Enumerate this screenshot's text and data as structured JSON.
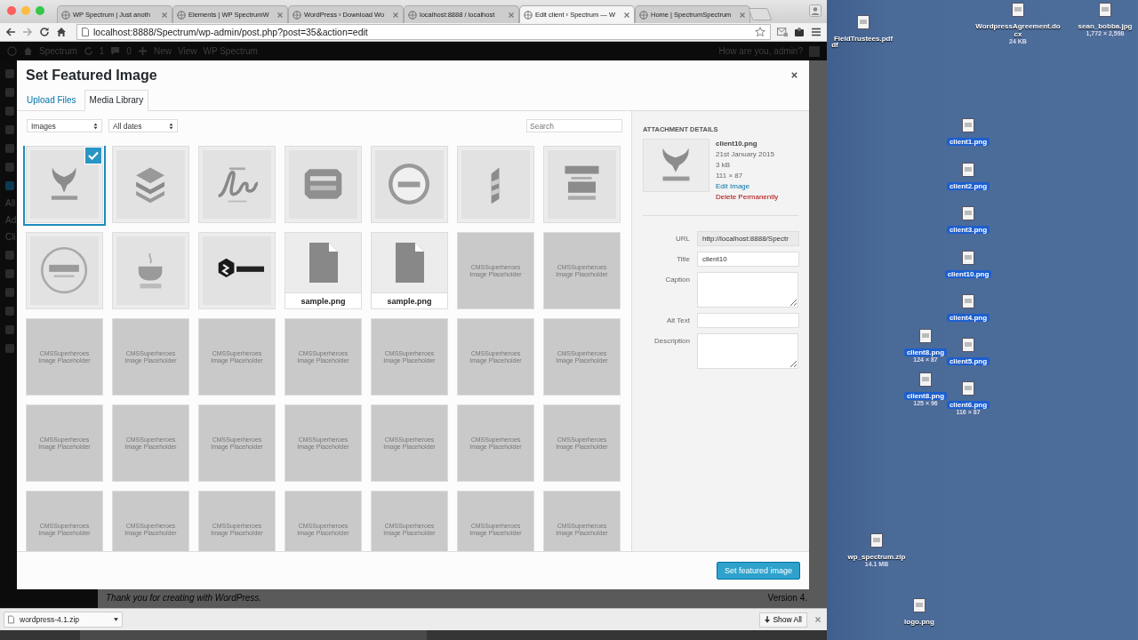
{
  "browser": {
    "tabs": [
      {
        "title": "WP Spectrum | Just anoth",
        "selected": false
      },
      {
        "title": "Elements | WP SpectrumW",
        "selected": false
      },
      {
        "title": "WordPress › Download Wo",
        "selected": false
      },
      {
        "title": "localhost:8888 / localhost",
        "selected": false
      },
      {
        "title": "Edit client ‹ Spectrum — W",
        "selected": true
      },
      {
        "title": "Home | SpectrumSpectrum",
        "selected": false
      }
    ],
    "url": "localhost:8888/Spectrum/wp-admin/post.php?post=35&action=edit"
  },
  "admin_bar": {
    "site": "Spectrum",
    "updates": "1",
    "comments": "0",
    "new": "New",
    "view": "View",
    "menu": "WP Spectrum",
    "greeting": "How are you, admin?"
  },
  "sidebar": {
    "items": [
      "All",
      "Ad",
      "Cli"
    ]
  },
  "modal": {
    "title": "Set Featured Image",
    "tabs": [
      {
        "label": "Upload Files",
        "selected": false
      },
      {
        "label": "Media Library",
        "selected": true
      }
    ],
    "filters": [
      "Images",
      "All dates"
    ],
    "search": {
      "placeholder": "Search"
    },
    "items": [
      {
        "kind": "logo",
        "selected": true
      },
      {
        "kind": "logo",
        "selected": false
      },
      {
        "kind": "logo",
        "selected": false
      },
      {
        "kind": "logo",
        "selected": false
      },
      {
        "kind": "logo",
        "selected": false
      },
      {
        "kind": "logo",
        "selected": false
      },
      {
        "kind": "logo",
        "selected": false
      },
      {
        "kind": "logo",
        "selected": false
      },
      {
        "kind": "logo",
        "selected": false
      },
      {
        "kind": "logo",
        "selected": false
      },
      {
        "kind": "file",
        "filename": "sample.png",
        "selected": false
      },
      {
        "kind": "file",
        "filename": "sample.png",
        "selected": false
      },
      {
        "kind": "placeholder",
        "text": "CMSSuperheroes Image Placeholder",
        "selected": false
      },
      {
        "kind": "placeholder",
        "text": "CMSSuperheroes Image Placeholder",
        "selected": false
      },
      {
        "kind": "placeholder",
        "text": "CMSSuperheroes Image Placeholder",
        "selected": false
      },
      {
        "kind": "placeholder",
        "text": "CMSSuperheroes Image Placeholder",
        "selected": false
      },
      {
        "kind": "placeholder",
        "text": "CMSSuperheroes Image Placeholder",
        "selected": false
      },
      {
        "kind": "placeholder",
        "text": "CMSSuperheroes Image Placeholder",
        "selected": false
      },
      {
        "kind": "placeholder",
        "text": "CMSSuperheroes Image Placeholder",
        "selected": false
      },
      {
        "kind": "placeholder",
        "text": "CMSSuperheroes Image Placeholder",
        "selected": false
      },
      {
        "kind": "placeholder",
        "text": "CMSSuperheroes Image Placeholder",
        "selected": false
      },
      {
        "kind": "placeholder",
        "text": "CMSSuperheroes Image Placeholder",
        "selected": false
      },
      {
        "kind": "placeholder",
        "text": "CMSSuperheroes Image Placeholder",
        "selected": false
      },
      {
        "kind": "placeholder",
        "text": "CMSSuperheroes Image Placeholder",
        "selected": false
      },
      {
        "kind": "placeholder",
        "text": "CMSSuperheroes Image Placeholder",
        "selected": false
      },
      {
        "kind": "placeholder",
        "text": "CMSSuperheroes Image Placeholder",
        "selected": false
      },
      {
        "kind": "placeholder",
        "text": "CMSSuperheroes Image Placeholder",
        "selected": false
      },
      {
        "kind": "placeholder",
        "text": "CMSSuperheroes Image Placeholder",
        "selected": false
      },
      {
        "kind": "placeholder",
        "text": "CMSSuperheroes Image Placeholder",
        "selected": false
      },
      {
        "kind": "placeholder",
        "text": "CMSSuperheroes Image Placeholder",
        "selected": false
      },
      {
        "kind": "placeholder",
        "text": "CMSSuperheroes Image Placeholder",
        "selected": false
      },
      {
        "kind": "placeholder",
        "text": "CMSSuperheroes Image Placeholder",
        "selected": false
      },
      {
        "kind": "placeholder",
        "text": "CMSSuperheroes Image Placeholder",
        "selected": false
      },
      {
        "kind": "placeholder",
        "text": "CMSSuperheroes Image Placeholder",
        "selected": false
      },
      {
        "kind": "placeholder",
        "text": "CMSSuperheroes Image Placeholder",
        "selected": false
      }
    ],
    "details": {
      "heading": "ATTACHMENT DETAILS",
      "filename": "client10.png",
      "date": "21st January 2015",
      "size": "3 kB",
      "dimensions": "111 × 87",
      "edit_link": "Edit Image",
      "delete_link": "Delete Permanently",
      "fields": [
        {
          "label": "URL",
          "kind": "readonly",
          "value": "http://localhost:8888/Spectr"
        },
        {
          "label": "Title",
          "kind": "input",
          "value": "client10"
        },
        {
          "label": "Caption",
          "kind": "textarea"
        },
        {
          "label": "Alt Text",
          "kind": "input"
        },
        {
          "label": "Description",
          "kind": "textarea"
        }
      ]
    },
    "button": "Set featured image"
  },
  "footer": {
    "thanks": "Thank you for creating with WordPress.",
    "version": "Version 4."
  },
  "download_shelf": {
    "file": "wordpress-4.1.zip",
    "show_all": "Show All"
  },
  "desktop": {
    "icons": [
      {
        "name": "FieldTrustees.pdf",
        "selected": false
      },
      {
        "name": "WordpressAgreement.docx",
        "info": "24 KB",
        "selected": false
      },
      {
        "name": "sean_bobba.jpg",
        "info": "1,772 × 2,598",
        "selected": false
      },
      {
        "name": "df",
        "selected": false
      },
      {
        "name": "client1.png",
        "selected": true
      },
      {
        "name": "client2.png",
        "selected": true
      },
      {
        "name": "client3.png",
        "selected": true
      },
      {
        "name": "client10.png",
        "selected": true
      },
      {
        "name": "client4.png",
        "selected": true
      },
      {
        "name": "client8.png",
        "info": "124 × 87",
        "selected": true
      },
      {
        "name": "client5.png",
        "selected": true
      },
      {
        "name": "client8.png",
        "info": "125 × 96",
        "selected": true
      },
      {
        "name": "client6.png",
        "info": "116 × 87",
        "selected": true
      },
      {
        "name": "wp_spectrum.zip",
        "info": "14.1 MB",
        "selected": false
      },
      {
        "name": "logo.png",
        "selected": false
      }
    ]
  }
}
